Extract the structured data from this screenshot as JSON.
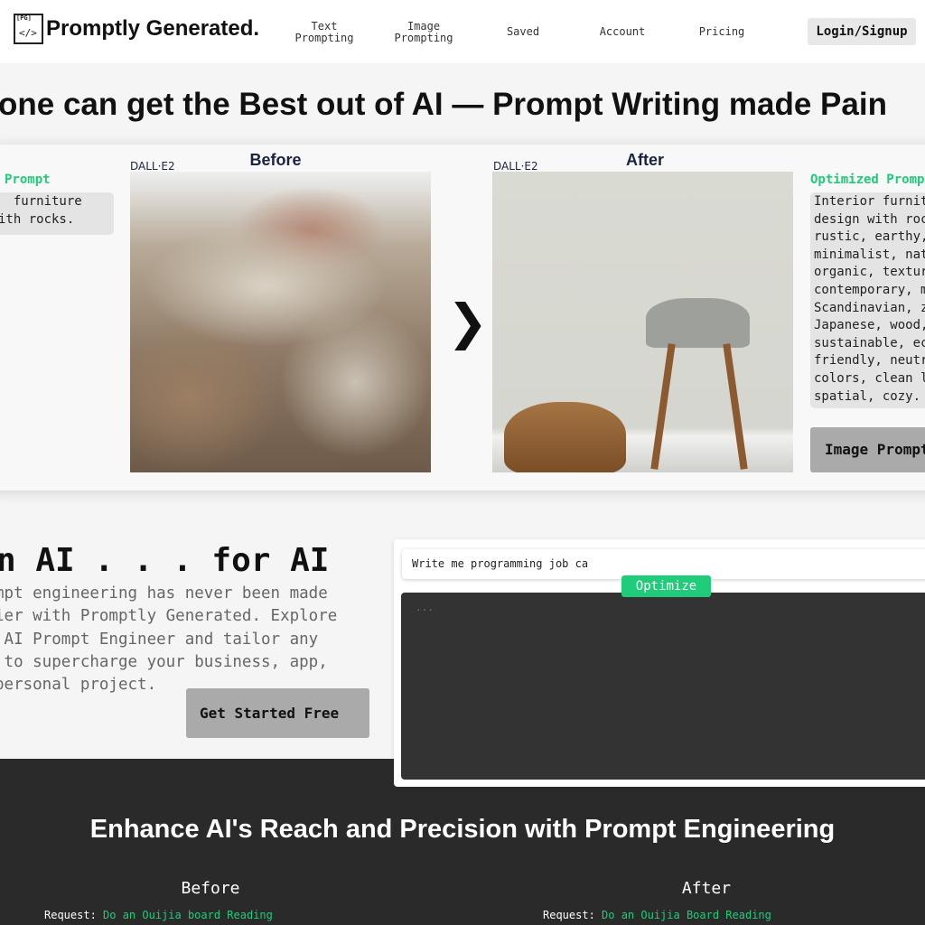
{
  "nav": {
    "brand": "Promptly Generated.",
    "logo_text": "[PG]",
    "items": [
      "Text\nPrompting",
      "Image\nPrompting",
      "Saved",
      "Account",
      "Pricing"
    ],
    "login": "Login/Signup"
  },
  "hero": {
    "headline": "one can get the Best out of AI —  Prompt Writing made Pain"
  },
  "demo": {
    "prompt_label": "Prompt",
    "prompt_text": "  furniture\nith rocks.",
    "before_model": "DALL·E2",
    "before_label": "Before",
    "after_model": "DALL·E2",
    "after_label": "After",
    "optimized_label": "Optimized Promp",
    "optimized_text": "Interior furnit\ndesign with roc\nrustic, earthy,\nminimalist, nat\norganic, textur\ncontemporary, m\nScandinavian, z\nJapanese, wood,\nsustainable, ec\nfriendly, neutr\ncolors, clean l\nspatial, cozy.",
    "button": "Image Prompt"
  },
  "section2": {
    "title": "n AI . . . for AI",
    "paragraph": "mpt engineering has never been made\nier with Promptly Generated. Explore\n AI Prompt Engineer and tailor any\n to supercharge your business, app,\npersonal project.",
    "cta": "Get Started Free",
    "input_value": "Write me programming job ca",
    "optimize": "Optimize",
    "output_placeholder": "..."
  },
  "footer": {
    "title": "Enhance AI's Reach and Precision with Prompt Engineering",
    "before": "Before",
    "after": "After",
    "request_label": "Request:",
    "before_request": "Do an Ouijia board Reading",
    "after_request": "Do an Ouijia Board Reading"
  },
  "colors": {
    "accent": "#1fcc7a",
    "dark": "#2a2a2a",
    "navy": "#1a2340"
  }
}
